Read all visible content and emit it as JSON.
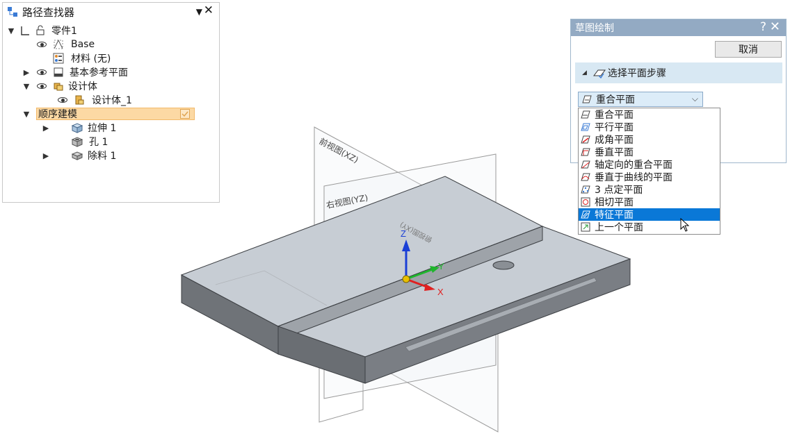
{
  "pathfinder": {
    "title": "路径查找器",
    "part_label": "零件1",
    "base_label": "Base",
    "material_label": "材料 (无)",
    "ref_planes_label": "基本参考平面",
    "design_body_label": "设计体",
    "design_body_1_label": "设计体_1",
    "ordered_modeling_label": "顺序建模",
    "extrude_label": "拉伸 1",
    "hole_label": "孔 1",
    "cut_label": "除料 1"
  },
  "viewport": {
    "front_plane_label": "前视图(XZ)",
    "right_plane_label": "右视图(YZ)",
    "top_plane_label": "俯视图(XY)",
    "axis_x": "X",
    "axis_y": "Y",
    "axis_z": "Z"
  },
  "sketch_dialog": {
    "title": "草图绘制",
    "help": "?",
    "close": "✕",
    "cancel_label": "取消",
    "step_label": "选择平面步骤",
    "combo_value": "重合平面"
  },
  "dropdown": {
    "options": [
      "重合平面",
      "平行平面",
      "成角平面",
      "垂直平面",
      "轴定向的重合平面",
      "垂直于曲线的平面",
      "3  点定平面",
      "相切平面",
      "特征平面",
      "上一个平面"
    ],
    "selected": "特征平面"
  },
  "colors": {
    "dialog_title_bg": "#93aac3",
    "step_bar_bg": "#d8e8f3",
    "selection_blue": "#0a78d7",
    "tree_highlight": "#fcd9a4",
    "part_top": "#c7cdd4",
    "part_side": "#7a7e84"
  }
}
